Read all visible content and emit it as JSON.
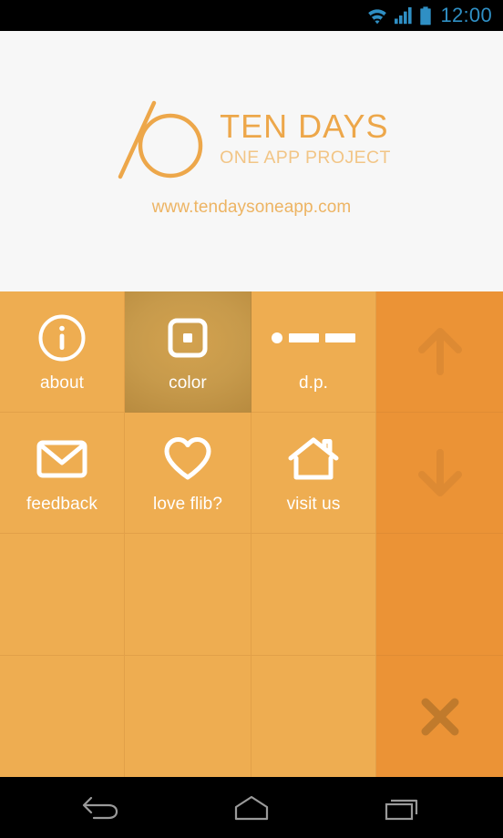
{
  "status_bar": {
    "time": "12:00",
    "icons": [
      "wifi-icon",
      "signal-icon",
      "battery-icon"
    ],
    "accent_color": "#2f8fc4",
    "background_color": "#000000"
  },
  "header": {
    "background_color": "#f7f7f7",
    "logo_mark": "slash-circle-logo",
    "title": "TEN DAYS",
    "subtitle": "ONE APP PROJECT",
    "url": "www.tendaysoneapp.com",
    "title_color": "#eda74a",
    "subtitle_color": "#f2c586",
    "url_color": "#edb463"
  },
  "grid": {
    "tile_color": "#eead51",
    "side_column_color": "#eb9336",
    "active_tile_color": "#c79a4b",
    "divider_color": "#e2a049",
    "label_color": "#ffffff",
    "rows": [
      [
        {
          "name": "about",
          "label": "about",
          "icon": "info-circle-icon",
          "state": "normal"
        },
        {
          "name": "color",
          "label": "color",
          "icon": "square-in-square-icon",
          "state": "active"
        },
        {
          "name": "dp",
          "label": "d.p.",
          "icon": "dot-dash-icon",
          "state": "normal"
        },
        {
          "name": "scroll-up",
          "label": "",
          "icon": "arrow-up-icon",
          "state": "side"
        }
      ],
      [
        {
          "name": "feedback",
          "label": "feedback",
          "icon": "envelope-icon",
          "state": "normal"
        },
        {
          "name": "love-flib",
          "label": "love flib?",
          "icon": "heart-icon",
          "state": "normal"
        },
        {
          "name": "visit-us",
          "label": "visit us",
          "icon": "house-icon",
          "state": "normal"
        },
        {
          "name": "scroll-down",
          "label": "",
          "icon": "arrow-down-icon",
          "state": "side"
        }
      ],
      [
        {
          "name": "empty-1",
          "label": "",
          "icon": "",
          "state": "normal"
        },
        {
          "name": "empty-2",
          "label": "",
          "icon": "",
          "state": "normal"
        },
        {
          "name": "empty-3",
          "label": "",
          "icon": "",
          "state": "normal"
        },
        {
          "name": "side-blank",
          "label": "",
          "icon": "",
          "state": "side"
        }
      ],
      [
        {
          "name": "empty-4",
          "label": "",
          "icon": "",
          "state": "normal"
        },
        {
          "name": "empty-5",
          "label": "",
          "icon": "",
          "state": "normal"
        },
        {
          "name": "empty-6",
          "label": "",
          "icon": "",
          "state": "normal"
        },
        {
          "name": "close",
          "label": "",
          "icon": "close-x-icon",
          "state": "side"
        }
      ]
    ]
  },
  "nav_bar": {
    "background_color": "#000000",
    "buttons": [
      {
        "name": "back",
        "icon": "back-arrow-icon"
      },
      {
        "name": "home",
        "icon": "home-icon"
      },
      {
        "name": "recents",
        "icon": "recents-icon"
      }
    ]
  }
}
